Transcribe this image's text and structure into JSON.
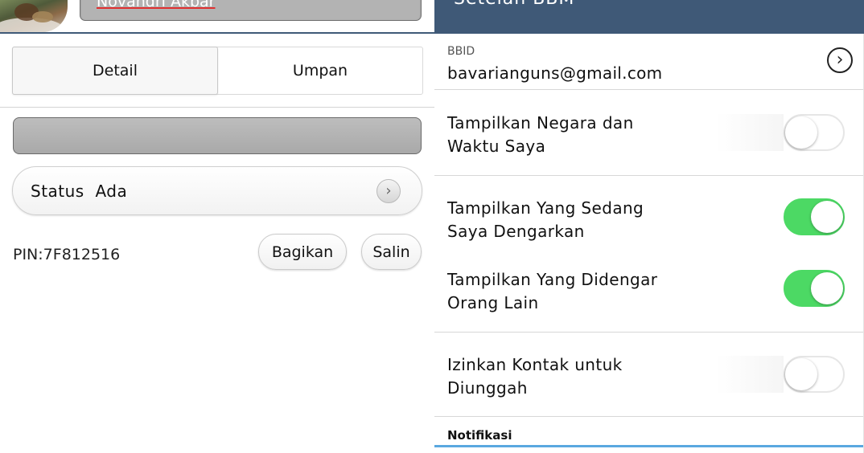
{
  "left": {
    "name_field": "Novandri Akbar",
    "tabs": [
      {
        "label": "Detail",
        "active": true
      },
      {
        "label": "Umpan",
        "active": false
      }
    ],
    "status_label": "Status  Ada",
    "pin": "PIN:7F812516",
    "share_label": "Bagikan",
    "copy_label": "Salin"
  },
  "right": {
    "title": "Setelan BBM",
    "bbid_label": "BBID",
    "bbid_value": "bavarianguns@gmail.com",
    "settings": [
      {
        "line1": "Tampilkan Negara dan",
        "line2": "Waktu Saya",
        "on": false
      },
      {
        "line1": "Tampilkan Yang Sedang",
        "line2": "Saya Dengarkan",
        "on": true
      },
      {
        "line1": "Tampilkan Yang Didengar",
        "line2": "Orang Lain",
        "on": true
      },
      {
        "line1": "Izinkan Kontak untuk",
        "line2": "Diunggah",
        "on": false
      }
    ],
    "section_label": "Notifikasi"
  },
  "colors": {
    "header_bg": "#3f5977",
    "toggle_on": "#4cd964",
    "section_line": "#5aa8e0"
  },
  "icons": {
    "status_chevron": "chevron-right-icon",
    "bbid_arrow": "chevron-right-circle-icon"
  }
}
